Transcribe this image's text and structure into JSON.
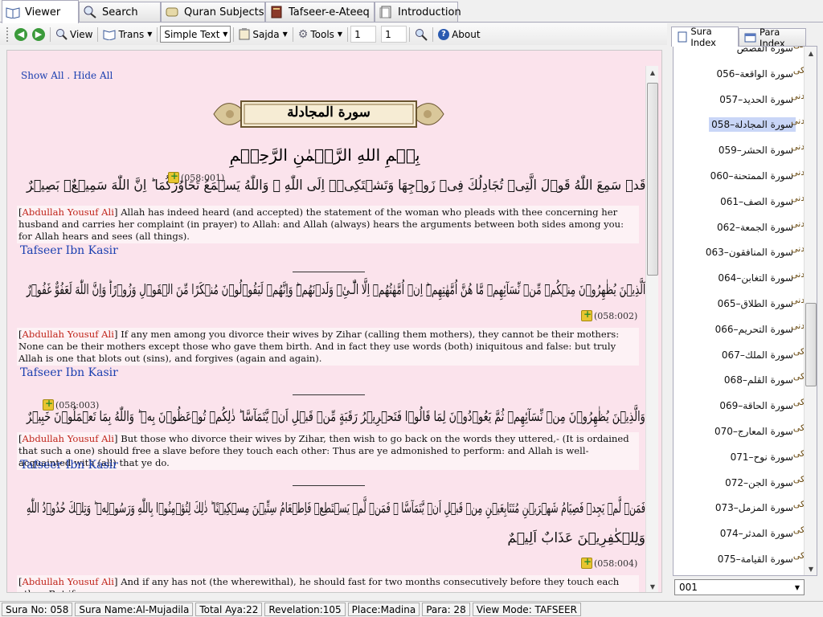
{
  "tabs": [
    {
      "label": "Viewer",
      "icon": "open-book-icon"
    },
    {
      "label": "Search",
      "icon": "magnifier-icon"
    },
    {
      "label": "Quran Subjects",
      "icon": "scroll-icon"
    },
    {
      "label": "Tafseer-e-Ateeq",
      "icon": "book-icon"
    },
    {
      "label": "Introduction",
      "icon": "page-icon"
    }
  ],
  "toolbar": {
    "view_label": "View",
    "trans_label": "Trans",
    "mode_value": "Simple Text",
    "sajda_label": "Sajda",
    "tools_label": "Tools",
    "sura_number": "1",
    "aya_number": "1",
    "about_label": "About"
  },
  "content": {
    "show_all": "Show All",
    "separator": " . ",
    "hide_all": "Hide All",
    "sura_title": "سورة المجادلة",
    "bismillah": "بِسۡمِ اللهِ الرَّحۡمٰنِ الرَّحِيۡمِ",
    "verses": [
      {
        "arabic": "قَدۡ سَمِعَ اللّٰهُ قَوۡلَ الَّتِىۡ تُجَادِلُكَ فِىۡ زَوۡجِهَا وَتَشۡتَكِىۡۤ اِلَى اللّٰهِ ‌ۖ وَاللّٰهُ يَسۡمَعُ تَحَاوُرَكُمَا‌ ؕ اِنَّ اللّٰهَ سَمِيۡعٌۢ بَصِيۡرٌ",
        "ref": "(058:001)",
        "translator": "Abdullah Yousuf Ali",
        "translation": "Allah has indeed heard (and accepted) the statement of the woman who pleads with thee concerning her husband and carries her complaint (in prayer) to Allah: and Allah (always) hears the arguments between both sides among you: for Allah hears and sees (all things).",
        "tafseer": "Tafseer Ibn Kasir"
      },
      {
        "arabic": "اَلَّذِيۡنَ يُظٰهِرُوۡنَ مِنۡكُمۡ مِّنۡ نِّسَآئِهِمۡ مَّا هُنَّ اُمَّهٰتِهِمۡ‌ؕ اِنۡ اُمَّهٰتُهُمۡ اِلَّا الّٰٓـىِٔۡ وَلَدۡنَهُمۡ‌ؕ وَاِنَّهُمۡ لَيَقُوۡلُوۡنَ مُنۡكَرًا مِّنَ الۡقَوۡلِ وَزُوۡرًا‌ؕ وَاِنَّ اللّٰهَ لَعَفُوٌّ غَفُوۡرٌ",
        "ref": "(058:002)",
        "translator": "Abdullah Yousuf Ali",
        "translation": "If any men among you divorce their wives by Zihar (calling them mothers), they cannot be their mothers: None can be their mothers except those who gave them birth. And in fact they use words (both) iniquitous and false: but truly Allah is one that blots out (sins), and forgives (again and again).",
        "tafseer": "Tafseer Ibn Kasir"
      },
      {
        "arabic": "وَالَّذِيۡنَ يُظٰهِرُوۡنَ مِنۡ نِّسَآئِهِمۡ ثُمَّ يَعُوۡدُوۡنَ لِمَا قَالُوۡا فَتَحۡرِيۡرُ رَقَبَةٍ مِّنۡ قَبۡلِ اَنۡ يَّتَمَآسَّا‌ ؕ ذٰلِكُمۡ تُوۡعَظُوۡنَ بِهٖ‌ ؕ وَاللّٰهُ بِمَا تَعۡمَلُوۡنَ خَبِيۡرٌ",
        "ref": "(058:003)",
        "translator": "Abdullah Yousuf Ali",
        "translation": "But those who divorce their wives by Zihar, then wish to go back on the words they uttered,- (It is ordained that such a one) should free a slave before they touch each other: Thus are ye admonished to perform: and Allah is well-acquainted with (all) that ye do.",
        "tafseer": "Tafseer Ibn Kasir"
      },
      {
        "arabic": "فَمَنۡ لَّمۡ يَجِدۡ فَصِيَامُ شَهۡرَيۡنِ مُتَتَابِعَيۡنِ مِنۡ قَبۡلِ اَنۡ يَّتَمَآسَّا ‌ۚ فَمَنۡ لَّمۡ يَسۡتَطِعۡ فَاِطۡعَامُ سِتِّيۡنَ مِسۡكِيۡنًا‌ ؕ ذٰلِكَ لِتُؤۡمِنُوۡا بِاللّٰهِ وَرَسُوۡلِهٖ‌ ؕ وَتِلۡكَ حُدُوۡدُ اللّٰهِ‌",
        "arabic2": "وَلِلۡكٰفِرِيۡنَ عَذَابٌ اَلِيۡمٌ",
        "ref": "(058:004)",
        "translator": "Abdullah Yousuf Ali",
        "translation": "And if any has not (the wherewithal), he should fast for two months consecutively before they touch each other. But if"
      }
    ]
  },
  "right_tabs": {
    "sura_index": "Sura Index",
    "para_index": "Para Index"
  },
  "sura_list": [
    {
      "label": "سورة القصص",
      "place": "مکی"
    },
    {
      "label": "056–سورة الواقعة",
      "place": "مکی"
    },
    {
      "label": "057–سورة الحديد",
      "place": "مدنی"
    },
    {
      "label": "058–سورة المجادلة",
      "place": "مدنی",
      "selected": true
    },
    {
      "label": "059–سورة الحشر",
      "place": "مدنی"
    },
    {
      "label": "060–سورة الممتحنة",
      "place": "مدنی"
    },
    {
      "label": "061–سورة الصف",
      "place": "مدنی"
    },
    {
      "label": "062–سورة الجمعة",
      "place": "مدنی"
    },
    {
      "label": "063–سورة المنافقون",
      "place": "مدنی"
    },
    {
      "label": "064–سورة التغابن",
      "place": "مدنی"
    },
    {
      "label": "065–سورة الطلاق",
      "place": "مدنی"
    },
    {
      "label": "066–سورة التحريم",
      "place": "مدنی"
    },
    {
      "label": "067–سورة الملك",
      "place": "مکی"
    },
    {
      "label": "068–سورة القلم",
      "place": "مکی"
    },
    {
      "label": "069–سورة الحاقة",
      "place": "مکی"
    },
    {
      "label": "070–سورة المعارج",
      "place": "مکی"
    },
    {
      "label": "071–سورة نوح",
      "place": "مکی"
    },
    {
      "label": "072–سورة الجن",
      "place": "مکی"
    },
    {
      "label": "073–سورة المزمل",
      "place": "مکی"
    },
    {
      "label": "074–سورة المدثر",
      "place": "مکی"
    },
    {
      "label": "075–سورة القيامة",
      "place": "مکی"
    }
  ],
  "para_select": "001",
  "status": {
    "sura_no": "Sura No: 058",
    "sura_name": "Sura Name:Al-Mujadila",
    "total_aya": "Total Aya:22",
    "revelation": "Revelation:105",
    "place": "Place:Madina",
    "para": "Para: 28",
    "view_mode": "View Mode: TAFSEER"
  },
  "colors": {
    "content_bg": "#fbe3ec",
    "link": "#1a3fb0",
    "translator": "#c0241a",
    "selected": "#c9d6f7"
  }
}
